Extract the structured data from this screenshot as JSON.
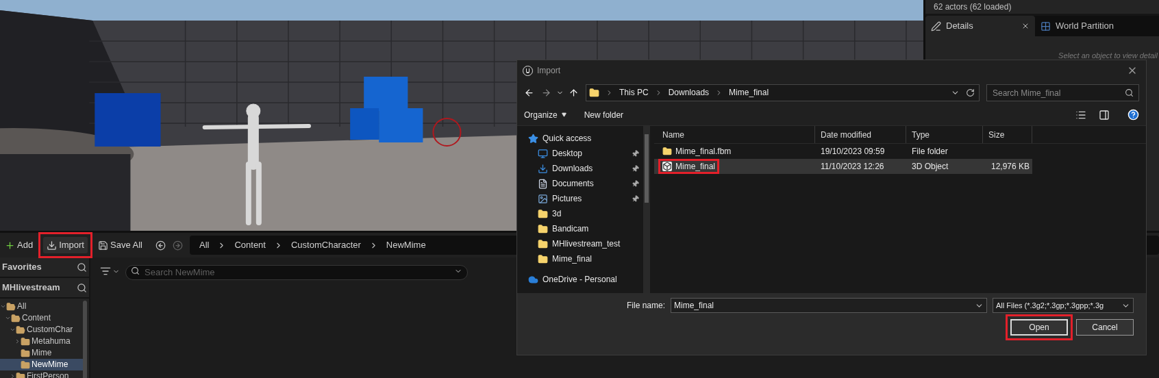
{
  "outliner_status": "62 actors (62 loaded)",
  "details_panel": {
    "tabs": [
      {
        "label": "Details",
        "selected": true,
        "closable": true
      },
      {
        "label": "World Partition",
        "selected": false,
        "closable": false
      }
    ],
    "empty_message": "Select an object to view detail"
  },
  "content_browser": {
    "toolbar": [
      {
        "kind": "add",
        "label": "Add"
      },
      {
        "kind": "import",
        "label": "Import",
        "highlighted": true
      },
      {
        "kind": "save",
        "label": "Save All"
      }
    ],
    "breadcrumbs": [
      "All",
      "Content",
      "CustomCharacter",
      "NewMime"
    ],
    "sources": [
      "Favorites",
      "MHlivestream"
    ],
    "tree": [
      {
        "label": "All",
        "expanded": true,
        "selected": false,
        "children": [
          {
            "label": "Content",
            "expanded": true,
            "selected": false,
            "children": [
              {
                "label": "CustomChar",
                "expanded": true,
                "selected": false,
                "children": [
                  {
                    "label": "Metahuma",
                    "expanded": false,
                    "selected": false
                  },
                  {
                    "label": "Mime",
                    "selected": false
                  },
                  {
                    "label": "NewMime",
                    "selected": true
                  }
                ]
              },
              {
                "label": "FirstPerson",
                "expanded": false,
                "selected": false
              }
            ]
          }
        ]
      }
    ],
    "search": {
      "placeholder": "Search NewMime"
    }
  },
  "dialog": {
    "title": "Import",
    "path": [
      "This PC",
      "Downloads",
      "Mime_final"
    ],
    "search": {
      "placeholder": "Search Mime_final"
    },
    "toolbar": [
      {
        "kind": "menu",
        "label": "Organize"
      },
      {
        "kind": "plain",
        "label": "New folder"
      }
    ],
    "nav": [
      {
        "kind": "quick-access",
        "label": "Quick access",
        "pinned": false
      },
      {
        "kind": "desktop",
        "label": "Desktop",
        "pinned": true
      },
      {
        "kind": "downloads",
        "label": "Downloads",
        "pinned": true
      },
      {
        "kind": "documents",
        "label": "Documents",
        "pinned": true
      },
      {
        "kind": "pictures",
        "label": "Pictures",
        "pinned": true
      },
      {
        "kind": "folder",
        "label": "3d",
        "pinned": false
      },
      {
        "kind": "folder",
        "label": "Bandicam",
        "pinned": false
      },
      {
        "kind": "folder",
        "label": "MHlivestream_test",
        "pinned": false
      },
      {
        "kind": "folder",
        "label": "Mime_final",
        "pinned": false
      },
      {
        "kind": "onedrive",
        "label": "OneDrive - Personal",
        "pinned": false
      }
    ],
    "columns": [
      "Name",
      "Date modified",
      "Type",
      "Size"
    ],
    "files": [
      {
        "kind": "folder",
        "name": "Mime_final.fbm",
        "date": "19/10/2023 09:59",
        "type": "File folder",
        "selected": false
      },
      {
        "kind": "object",
        "name": "Mime_final",
        "date": "11/10/2023 12:26",
        "type": "3D Object",
        "size": "12,976 KB",
        "selected": true,
        "highlighted": true
      }
    ],
    "file_name": {
      "label": "File name:",
      "value": "Mime_final"
    },
    "file_type": "All Files (*.3g2;*.3gp;*.3gpp;*.3g",
    "buttons": [
      {
        "kind": "primary",
        "label": "Open",
        "highlighted": true
      },
      {
        "kind": "secondary",
        "label": "Cancel"
      }
    ]
  }
}
